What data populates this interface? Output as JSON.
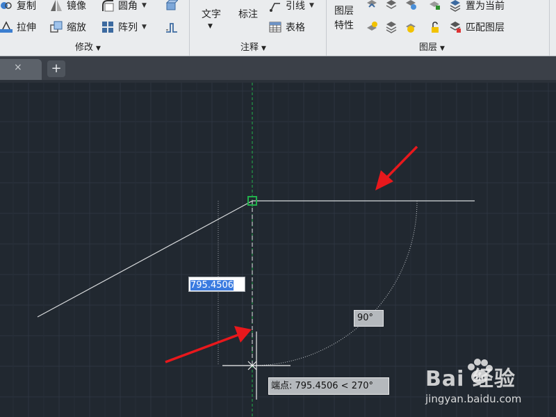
{
  "ribbon": {
    "modify": {
      "copy": "复制",
      "mirror": "镜像",
      "fillet": "圆角",
      "stretch": "拉伸",
      "scale": "缩放",
      "array": "阵列",
      "title": "修改"
    },
    "annotation": {
      "text": "文字",
      "dimension": "标注",
      "leader": "引线",
      "table": "表格",
      "title": "注释"
    },
    "layers": {
      "properties_line1": "图层",
      "properties_line2": "特性",
      "set_current": "置为当前",
      "match_layer": "匹配图层",
      "title": "图层"
    }
  },
  "tabs": {
    "close_glyph": "×",
    "new_tab_glyph": "+"
  },
  "drawing": {
    "length_input": "795.4506",
    "angle_value": "90°",
    "coord_tooltip": "端点: 795.4506 < 270°",
    "colors": {
      "background": "#212830",
      "grid": "#2d3541",
      "polar_track": "#22b14c",
      "line": "#d8dadc",
      "arrow": "#e8181c"
    }
  },
  "watermark": {
    "brand": "Bai 经验",
    "url": "jingyan.baidu.com"
  }
}
